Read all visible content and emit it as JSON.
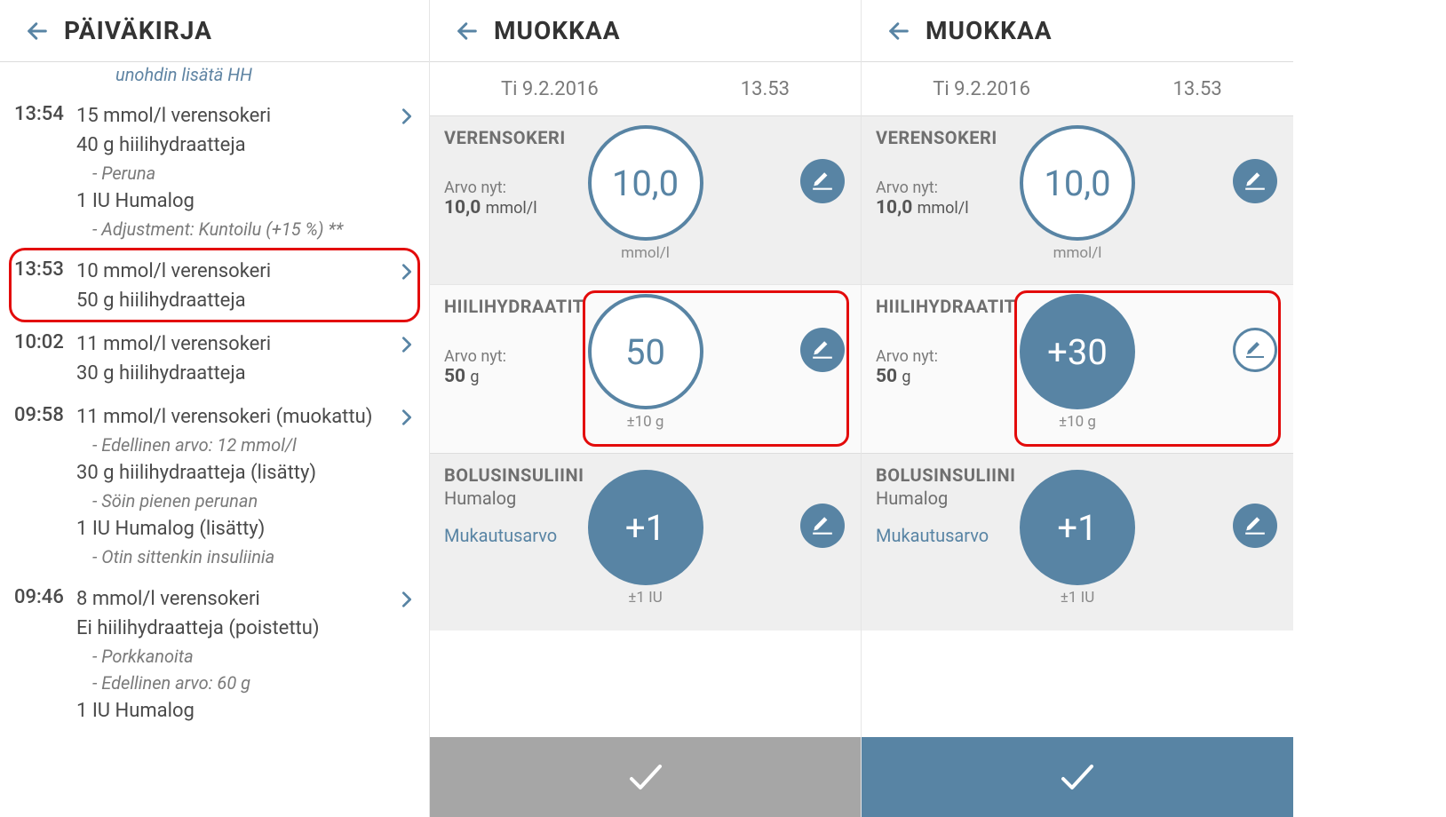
{
  "colors": {
    "accent": "#5884a4",
    "highlight": "#e30b0b"
  },
  "screen1": {
    "title": "PÄIVÄKIRJA",
    "truncated_note": "unohdin lisätä HH",
    "entries": [
      {
        "time": "13:54",
        "lines": [
          {
            "text": "15 mmol/l verensokeri",
            "sub": false
          },
          {
            "text": "40 g hiilihydraatteja",
            "sub": false
          },
          {
            "text": "- Peruna",
            "sub": true
          },
          {
            "text": "1 IU Humalog",
            "sub": false
          },
          {
            "text": "- Adjustment: Kuntoilu (+15 %) **",
            "sub": true
          }
        ]
      },
      {
        "time": "13:53",
        "highlighted": true,
        "lines": [
          {
            "text": "10 mmol/l verensokeri",
            "sub": false
          },
          {
            "text": "50 g hiilihydraatteja",
            "sub": false
          }
        ]
      },
      {
        "time": "10:02",
        "lines": [
          {
            "text": "11 mmol/l verensokeri",
            "sub": false
          },
          {
            "text": "30 g hiilihydraatteja",
            "sub": false
          }
        ]
      },
      {
        "time": "09:58",
        "lines": [
          {
            "text": "11 mmol/l verensokeri (muokattu)",
            "sub": false
          },
          {
            "text": "- Edellinen arvo: 12 mmol/l",
            "sub": true
          },
          {
            "text": "30 g hiilihydraatteja (lisätty)",
            "sub": false
          },
          {
            "text": "- Söin pienen perunan",
            "sub": true
          },
          {
            "text": "1 IU Humalog (lisätty)",
            "sub": false
          },
          {
            "text": "- Otin sittenkin insuliinia",
            "sub": true
          }
        ]
      },
      {
        "time": "09:46",
        "lines": [
          {
            "text": "8 mmol/l verensokeri",
            "sub": false
          },
          {
            "text": "Ei hiilihydraatteja (poistettu)",
            "sub": false
          },
          {
            "text": "- Porkkanoita",
            "sub": true
          },
          {
            "text": "- Edellinen arvo: 60 g",
            "sub": true
          },
          {
            "text": "1 IU Humalog",
            "sub": false
          }
        ]
      }
    ]
  },
  "edit_common": {
    "title": "MUOKKAA",
    "date": "Ti 9.2.2016",
    "time": "13.53",
    "bg_title": "VERENSOKERI",
    "bg_value": "10,0",
    "bg_unit": "mmol/l",
    "bg_now_label": "Arvo nyt:",
    "bg_now_value": "10,0",
    "bg_now_unit": "mmol/l",
    "carb_title": "HIILIHYDRAATIT",
    "carb_unit": "±10 g",
    "carb_now_label": "Arvo nyt:",
    "carb_now_value": "50",
    "carb_now_unit": "g",
    "bolus_title": "BOLUSINSULIINI",
    "bolus_sub": "Humalog",
    "bolus_link": "Mukautusarvo",
    "bolus_value": "+1",
    "bolus_unit": "±1 IU"
  },
  "screen2": {
    "carb_value": "50",
    "carb_style": "white",
    "edit_style": "blue",
    "confirm_style": "gray"
  },
  "screen3": {
    "carb_value": "+30",
    "carb_style": "blue",
    "edit_style": "white",
    "confirm_style": "blue"
  }
}
